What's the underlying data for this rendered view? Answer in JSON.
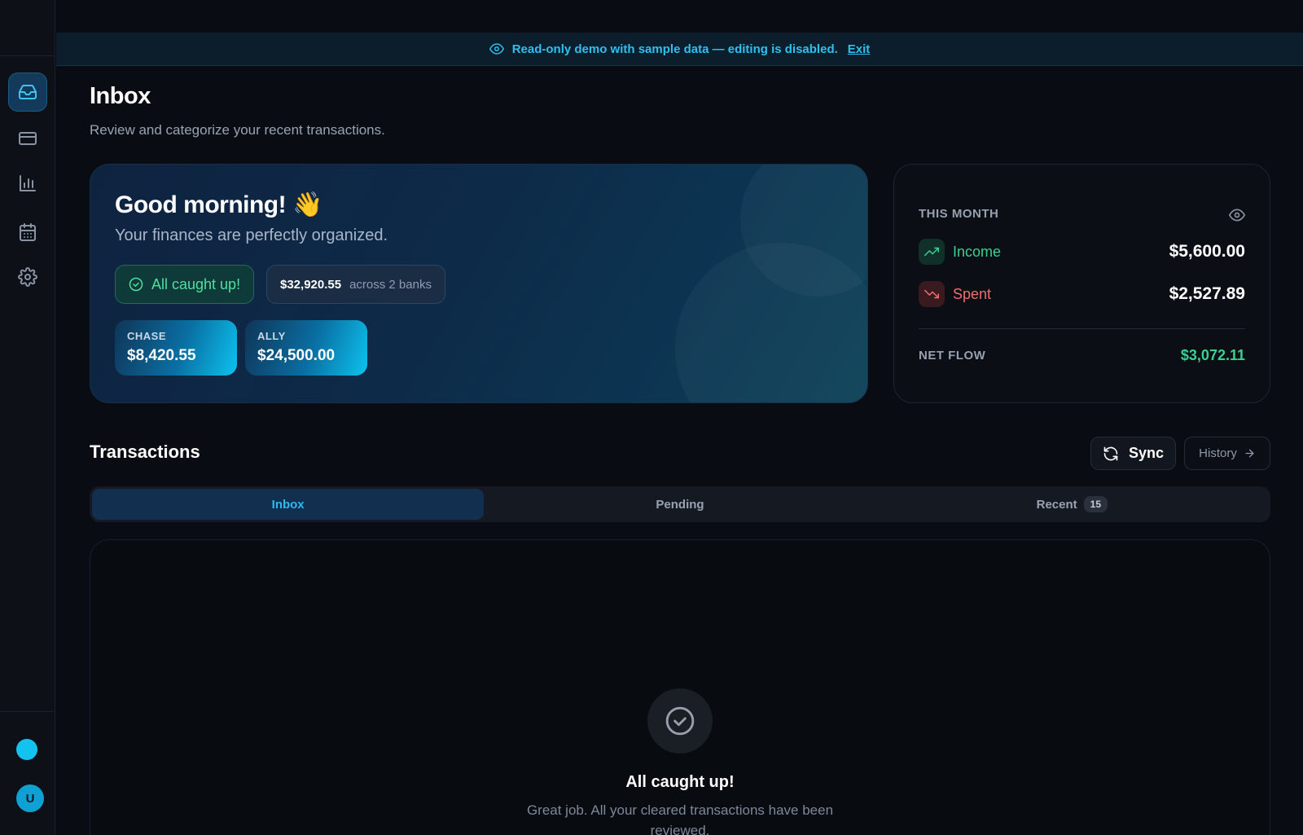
{
  "banner": {
    "message": "Read-only demo with sample data — editing is disabled.",
    "exit_label": "Exit"
  },
  "sidebar": {
    "items": [
      {
        "icon": "inbox-icon",
        "active": true
      },
      {
        "icon": "credit-card-icon",
        "active": false
      },
      {
        "icon": "bar-chart-icon",
        "active": false
      },
      {
        "icon": "calendar-icon",
        "active": false
      },
      {
        "icon": "settings-icon",
        "active": false
      }
    ],
    "avatar_initial": "U"
  },
  "header": {
    "title": "Inbox",
    "subtitle": "Review and categorize your recent transactions."
  },
  "greeting": {
    "title": "Good morning! 👋",
    "subtitle": "Your finances are perfectly organized.",
    "caught_up_label": "All caught up!",
    "total_balance": "$32,920.55",
    "across_label": "across 2 banks",
    "banks": [
      {
        "name": "CHASE",
        "amount": "$8,420.55"
      },
      {
        "name": "ALLY",
        "amount": "$24,500.00"
      }
    ]
  },
  "this_month": {
    "label": "THIS MONTH",
    "income_label": "Income",
    "income_value": "$5,600.00",
    "spent_label": "Spent",
    "spent_value": "$2,527.89",
    "net_label": "NET FLOW",
    "net_value": "$3,072.11"
  },
  "transactions": {
    "title": "Transactions",
    "sync_label": "Sync",
    "history_label": "History",
    "tabs": [
      {
        "label": "Inbox",
        "active": true
      },
      {
        "label": "Pending",
        "active": false
      },
      {
        "label": "Recent",
        "count": "15",
        "active": false
      }
    ],
    "empty_title": "All caught up!",
    "empty_text": "Great job. All your cleared transactions have been reviewed."
  },
  "colors": {
    "accent": "#2ec0f0",
    "income": "#3ccf8e",
    "spent": "#f26d6d",
    "background": "#090c12"
  }
}
